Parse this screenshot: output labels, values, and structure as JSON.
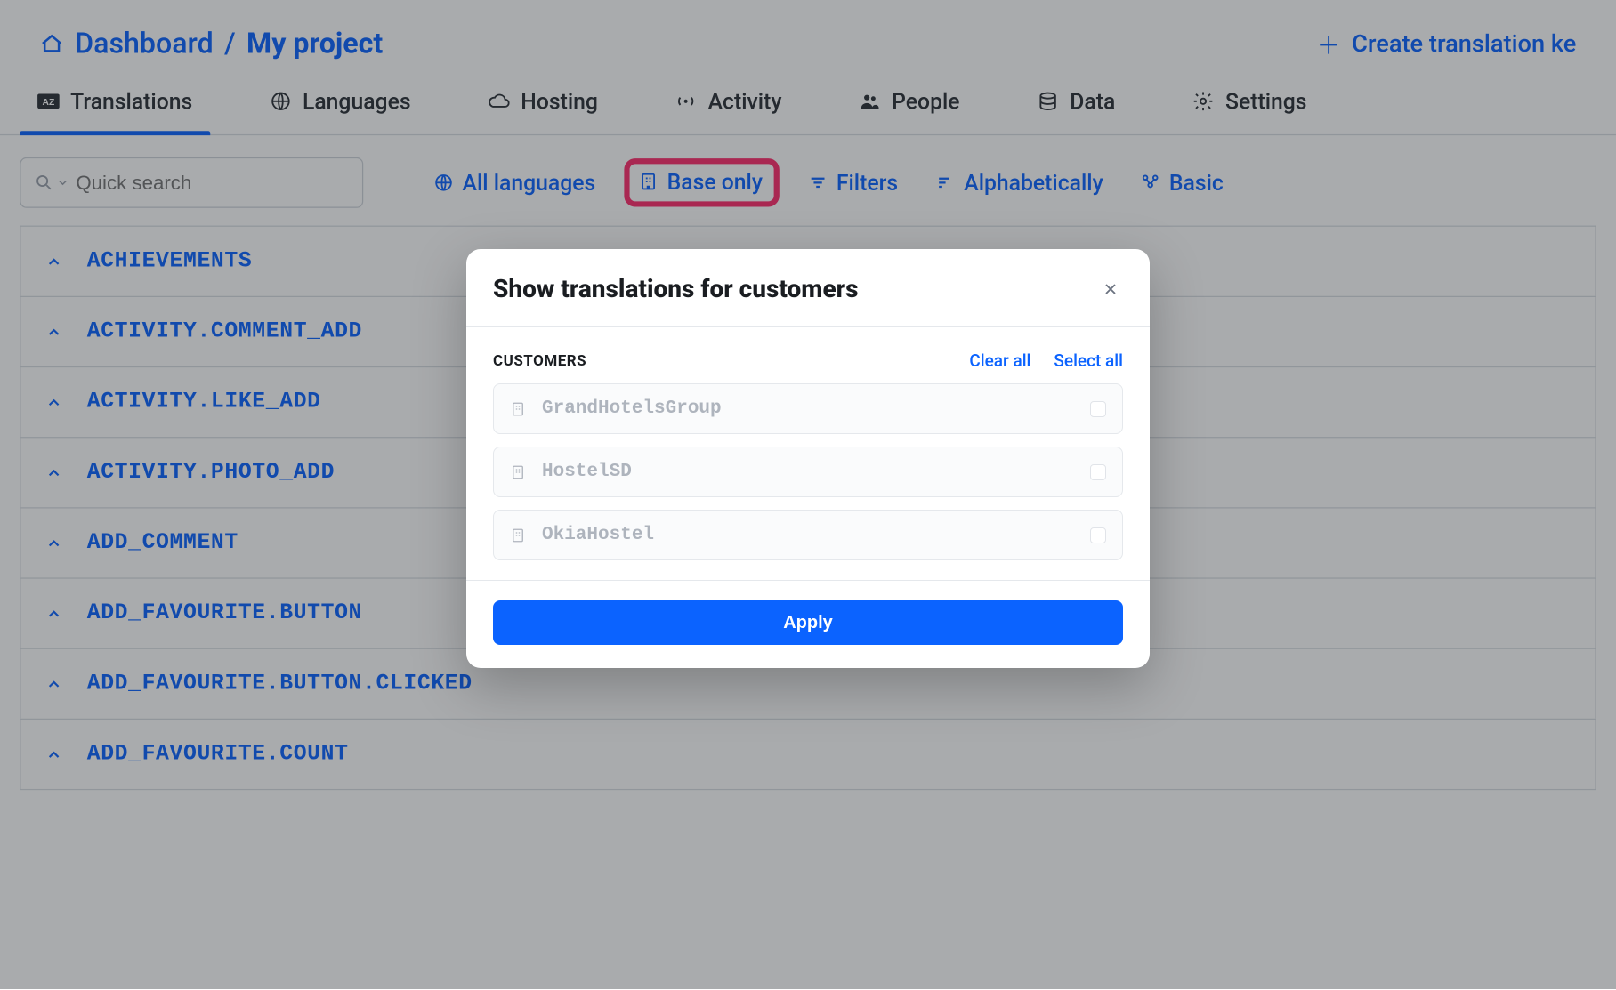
{
  "breadcrumb": {
    "home": "Dashboard",
    "current": "My project"
  },
  "header": {
    "create_label": "Create translation ke"
  },
  "tabs": [
    {
      "label": "Translations",
      "icon": "az",
      "active": true
    },
    {
      "label": "Languages",
      "icon": "globe",
      "active": false
    },
    {
      "label": "Hosting",
      "icon": "cloud",
      "active": false
    },
    {
      "label": "Activity",
      "icon": "signal",
      "active": false
    },
    {
      "label": "People",
      "icon": "people",
      "active": false
    },
    {
      "label": "Data",
      "icon": "database",
      "active": false
    },
    {
      "label": "Settings",
      "icon": "gear",
      "active": false
    }
  ],
  "toolbar": {
    "search_placeholder": "Quick search",
    "all_languages": "All languages",
    "base_only": "Base only",
    "filters": "Filters",
    "sort": "Alphabetically",
    "view": "Basic"
  },
  "keys": [
    "ACHIEVEMENTS",
    "ACTIVITY.COMMENT_ADD",
    "ACTIVITY.LIKE_ADD",
    "ACTIVITY.PHOTO_ADD",
    "ADD_COMMENT",
    "ADD_FAVOURITE.BUTTON",
    "ADD_FAVOURITE.BUTTON.CLICKED",
    "ADD_FAVOURITE.COUNT"
  ],
  "modal": {
    "title": "Show translations for customers",
    "section_label": "CUSTOMERS",
    "clear_all": "Clear all",
    "select_all": "Select all",
    "customers": [
      {
        "name": "GrandHotelsGroup",
        "checked": false
      },
      {
        "name": "HostelSD",
        "checked": false
      },
      {
        "name": "OkiaHostel",
        "checked": false
      }
    ],
    "apply": "Apply"
  },
  "colors": {
    "accent": "#0b63ff",
    "highlight": "#ff2d6c"
  }
}
